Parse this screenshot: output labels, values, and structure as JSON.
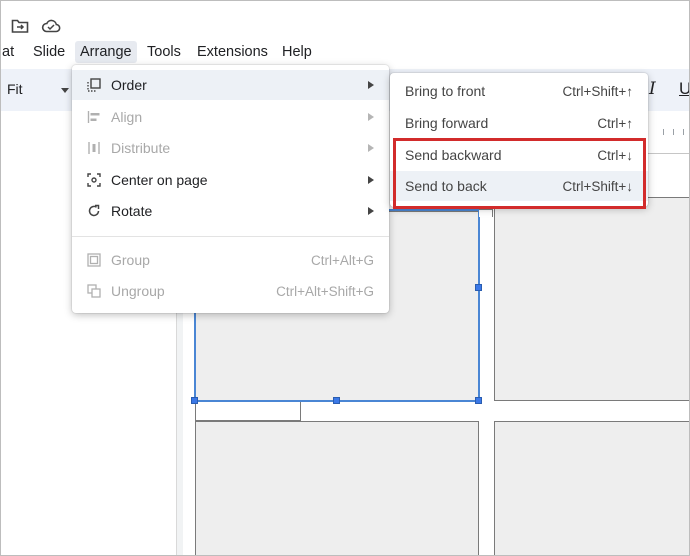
{
  "toolbar_top": {
    "icons": [
      "folder-move-icon",
      "cloud-saved-icon"
    ]
  },
  "menubar": {
    "items": [
      {
        "id": "format",
        "label": "at"
      },
      {
        "id": "slide",
        "label": "Slide"
      },
      {
        "id": "arrange",
        "label": "Arrange"
      },
      {
        "id": "tools",
        "label": "Tools"
      },
      {
        "id": "extensions",
        "label": "Extensions"
      },
      {
        "id": "help",
        "label": "Help"
      }
    ]
  },
  "toolbar": {
    "zoom_value": "Fit",
    "italic_label": "I",
    "underline_label": "U"
  },
  "arrange_menu": {
    "items": [
      {
        "label": "Order",
        "icon": "order-icon",
        "has_submenu": true,
        "enabled": true
      },
      {
        "label": "Align",
        "icon": "align-icon",
        "has_submenu": true,
        "enabled": false
      },
      {
        "label": "Distribute",
        "icon": "distribute-icon",
        "has_submenu": true,
        "enabled": false
      },
      {
        "label": "Center on page",
        "icon": "center-on-page-icon",
        "has_submenu": true,
        "enabled": true
      },
      {
        "label": "Rotate",
        "icon": "rotate-icon",
        "has_submenu": true,
        "enabled": true
      },
      {
        "label": "Group",
        "icon": "group-icon",
        "shortcut": "Ctrl+Alt+G",
        "enabled": false
      },
      {
        "label": "Ungroup",
        "icon": "ungroup-icon",
        "shortcut": "Ctrl+Alt+Shift+G",
        "enabled": false
      }
    ]
  },
  "order_submenu": {
    "items": [
      {
        "label": "Bring to front",
        "shortcut": "Ctrl+Shift+↑"
      },
      {
        "label": "Bring forward",
        "shortcut": "Ctrl+↑"
      },
      {
        "label": "Send backward",
        "shortcut": "Ctrl+↓"
      },
      {
        "label": "Send to back",
        "shortcut": "Ctrl+Shift+↓"
      }
    ]
  },
  "annotation": {
    "highlight_color": "#d22b2b"
  }
}
